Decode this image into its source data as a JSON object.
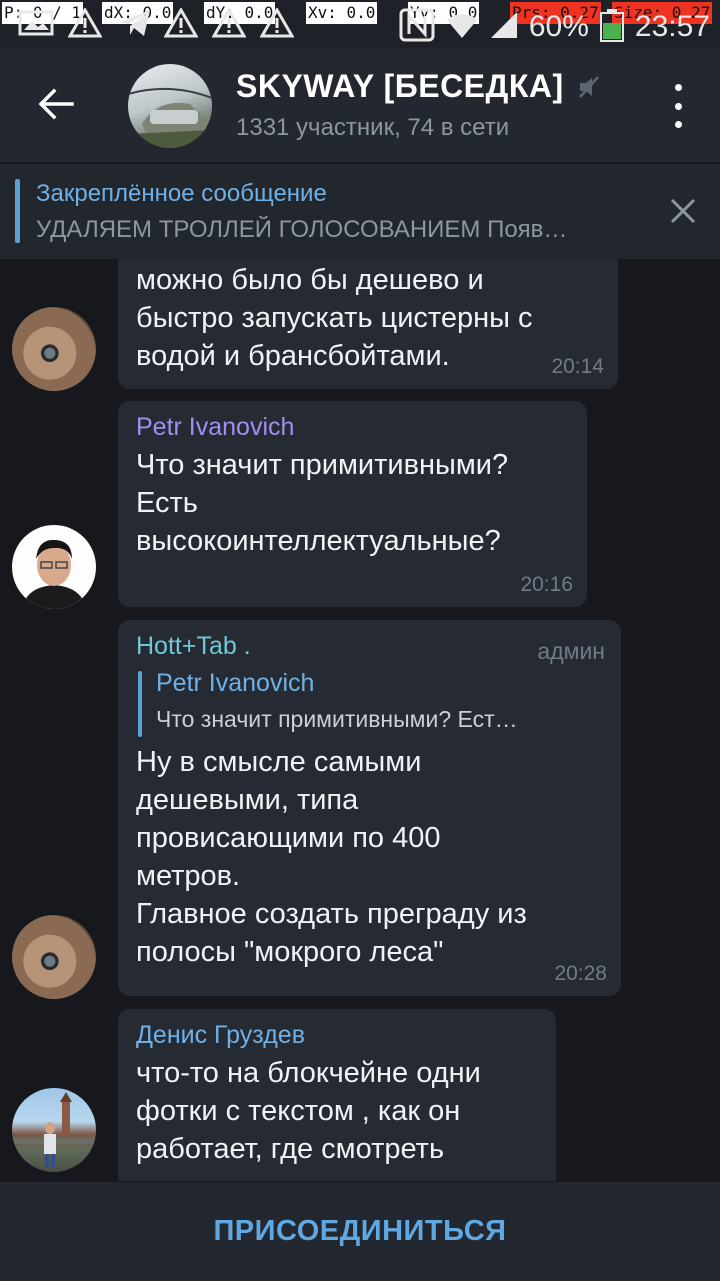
{
  "status_bar": {
    "debug": {
      "p": "P: 0 / 1",
      "dx": "dX: 0.0",
      "dy": "dY: 0.0",
      "xv": "Xv: 0.0",
      "yv": "Yv: 0.0",
      "prs": "Prs: 0.27",
      "size": "Size: 0.27"
    },
    "battery_text": "60%",
    "time": "23:57"
  },
  "header": {
    "back_icon": "arrow-left-icon",
    "title": "SKYWAY [БЕСЕДКА]",
    "muted_icon": "muted-speaker-icon",
    "subtitle": "1331 участник, 74 в сети",
    "menu_icon": "more-vertical-icon"
  },
  "pinned": {
    "title": "Закреплённое сообщение",
    "text": "УДАЛЯЕМ ТРОЛЛЕЙ ГОЛОСОВАНИЕМ  Появ…",
    "close_icon": "close-icon"
  },
  "messages": [
    {
      "text": "можно было бы дешево и\nбыстро запускать цистерны с\nводой и брансбойтами.",
      "time": "20:14"
    },
    {
      "sender": "Petr Ivanovich",
      "sender_color": "#a18ff0",
      "text": "Что значит примитивными?\nЕсть\nвысокоинтеллектуальные?",
      "time": "20:16"
    },
    {
      "sender": "Hott+Tab .",
      "sender_color": "#6fc8d6",
      "badge": "админ",
      "reply_sender": "Petr Ivanovich",
      "reply_text": "Что значит примитивными? Ест…",
      "text": "Ну в смысле самыми\nдешевыми, типа\nпровисающими по 400\nметров.\nГлавное создать преграду из\nполосы \"мокрого леса\"",
      "time": "20:28"
    },
    {
      "sender": "Денис Груздев",
      "sender_color": "#6fb1e6",
      "text": "что-то на блокчейне одни\nфотки с текстом , как он\nработает, где смотреть"
    }
  ],
  "join_bar": {
    "button": "ПРИСОЕДИНИТЬСЯ"
  },
  "colors": {
    "accent": "#5fa8e3",
    "bubble": "#262b33",
    "background": "#17181d"
  }
}
